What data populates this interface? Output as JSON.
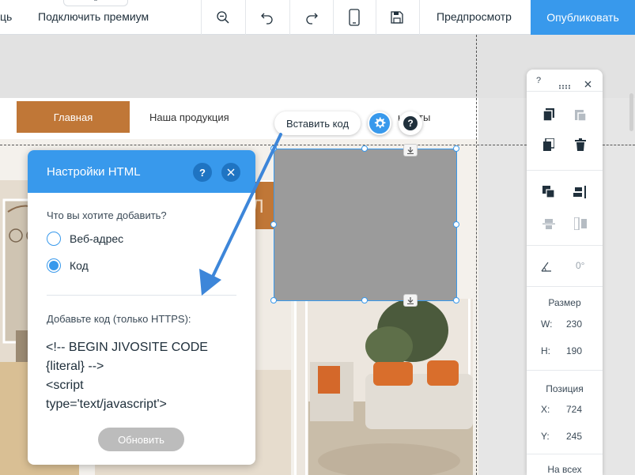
{
  "topbar": {
    "left_cut_text": "ць",
    "premium_label": "Подключить премиум",
    "preview_label": "Предпросмотр",
    "publish_label": "Опубликовать",
    "icons": [
      "zoom-out-icon",
      "undo-icon",
      "redo-icon",
      "mobile-icon",
      "save-icon"
    ]
  },
  "site": {
    "nav": {
      "home": "Главная",
      "products": "Наша продукция",
      "contacts": "нтакты"
    },
    "banner_fragment": "Л"
  },
  "embed_toolbar": {
    "embed_label": "Вставить код"
  },
  "dialog": {
    "title": "Настройки HTML",
    "question": "Что вы хотите добавить?",
    "options": [
      {
        "label": "Веб-адрес",
        "selected": false
      },
      {
        "label": "Код",
        "selected": true
      }
    ],
    "code_label": "Добавьте код (только HTTPS):",
    "code_lines": [
      "<!-- BEGIN JIVOSITE CODE",
      "{literal} -->",
      "<script",
      "type='text/javascript'>"
    ],
    "update_label": "Обновить"
  },
  "tool_panel": {
    "help": "?",
    "rotation_value": "0°",
    "size_title": "Размер",
    "w_label": "W:",
    "w_value": "230",
    "h_label": "H:",
    "h_value": "190",
    "position_title": "Позиция",
    "x_label": "X:",
    "x_value": "724",
    "y_label": "Y:",
    "y_value": "245",
    "bottom_label": "На всех"
  },
  "colors": {
    "accent": "#3899ec",
    "brand_orange": "#c07737",
    "embed_placeholder": "#9b9b9b"
  }
}
